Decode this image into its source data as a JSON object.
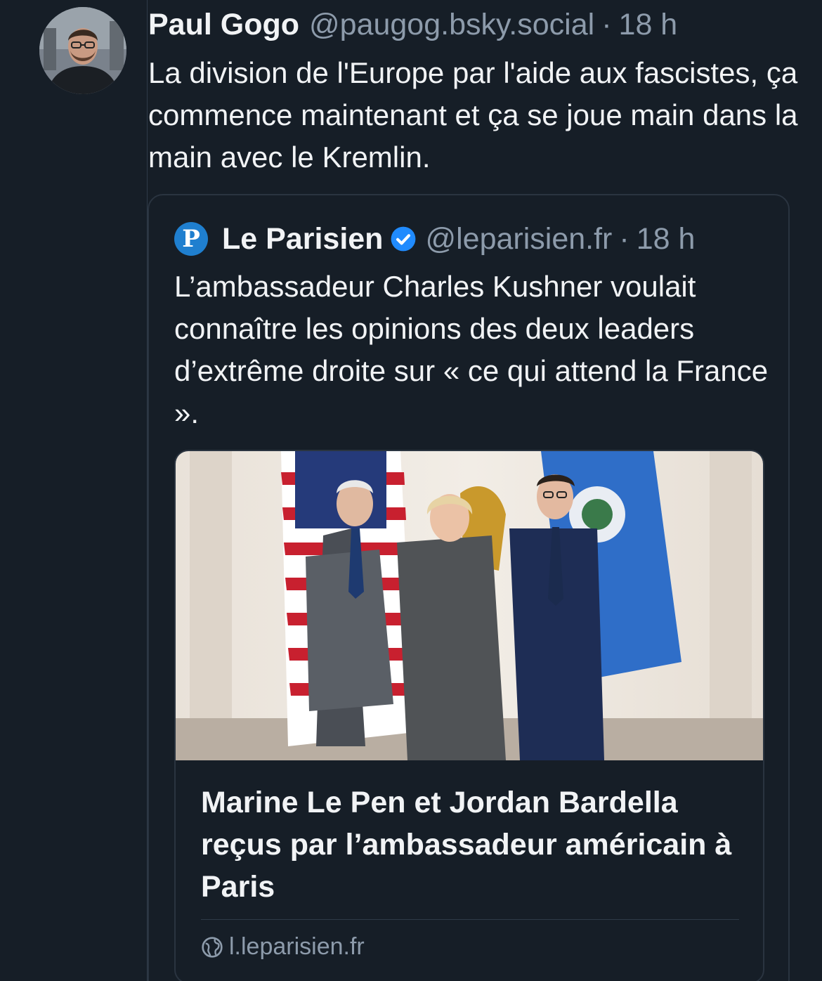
{
  "post": {
    "author_name": "Paul Gogo",
    "handle": "@paugog.bsky.social",
    "separator": "·",
    "time": "18 h",
    "avatar_icon": "user-avatar-photo",
    "text": "La division de l'Europe par l'aide aux fascistes, ça commence maintenant et ça se joue main dans la main avec le Kremlin."
  },
  "quote": {
    "avatar_letter": "P",
    "author_name": "Le Parisien",
    "verified_icon": "verified-check-icon",
    "handle": "@leparisien.fr",
    "separator": "·",
    "time": "18 h",
    "text": "L’ambassadeur Charles Kushner voulait connaître les opinions des deux leaders d’extrême droite sur « ce qui attend la France ».",
    "embed": {
      "image_icon": "photo-three-people-with-flags",
      "title": "Marine Le Pen et Jordan Bardella reçus par l’ambassadeur américain à Paris",
      "domain_icon": "globe-icon",
      "domain": "l.leparisien.fr"
    }
  },
  "colors": {
    "background": "#161e27",
    "text_primary": "#f1f3f5",
    "text_secondary": "#8d9bab",
    "border": "#2a3440",
    "verified": "#208bfe"
  }
}
